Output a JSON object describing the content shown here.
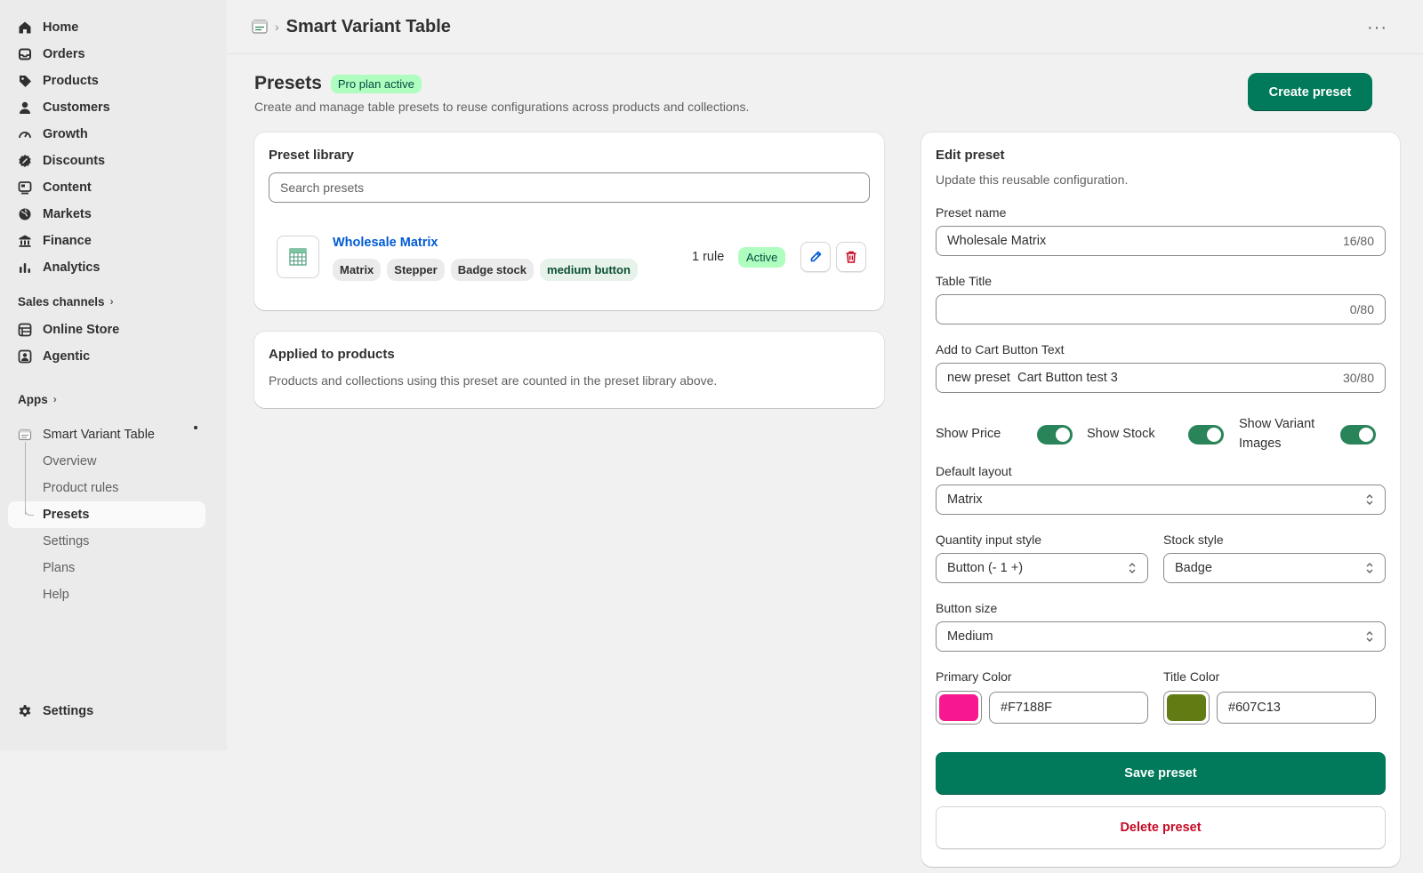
{
  "sidebar": {
    "nav": [
      {
        "label": "Home",
        "icon": "home-icon"
      },
      {
        "label": "Orders",
        "icon": "inbox-icon"
      },
      {
        "label": "Products",
        "icon": "tag-icon"
      },
      {
        "label": "Customers",
        "icon": "person-icon"
      },
      {
        "label": "Growth",
        "icon": "gauge-icon"
      },
      {
        "label": "Discounts",
        "icon": "discount-icon"
      },
      {
        "label": "Content",
        "icon": "content-icon"
      },
      {
        "label": "Markets",
        "icon": "globe-icon"
      },
      {
        "label": "Finance",
        "icon": "bank-icon"
      },
      {
        "label": "Analytics",
        "icon": "bar-chart-icon"
      }
    ],
    "sales_channels_label": "Sales channels",
    "channels": [
      {
        "label": "Online Store",
        "icon": "store-icon"
      },
      {
        "label": "Agentic",
        "icon": "agent-icon"
      }
    ],
    "apps_label": "Apps",
    "app_name": "Smart Variant Table",
    "app_items": [
      "Overview",
      "Product rules",
      "Presets",
      "Settings",
      "Plans",
      "Help"
    ],
    "settings_label": "Settings"
  },
  "topbar": {
    "title": "Smart Variant Table",
    "separator": "›",
    "more": "···"
  },
  "page": {
    "title": "Presets",
    "badge": "Pro plan active",
    "subtitle": "Create and manage table presets to reuse configurations across products and collections.",
    "create_button": "Create preset"
  },
  "library": {
    "title": "Preset library",
    "search_placeholder": "Search presets",
    "preset": {
      "name": "Wholesale Matrix",
      "tags": [
        "Matrix",
        "Stepper",
        "Badge stock",
        "medium button"
      ],
      "rules": "1 rule",
      "status": "Active"
    }
  },
  "applied": {
    "title": "Applied to products",
    "description": "Products and collections using this preset are counted in the preset library above."
  },
  "edit": {
    "title": "Edit preset",
    "subtitle": "Update this reusable configuration.",
    "preset_name_label": "Preset name",
    "preset_name_value": "Wholesale Matrix",
    "preset_name_count": "16/80",
    "table_title_label": "Table Title",
    "table_title_value": "",
    "table_title_count": "0/80",
    "cart_text_label": "Add to Cart Button Text",
    "cart_text_value": "new preset  Cart Button test 3",
    "cart_text_count": "30/80",
    "toggles": [
      {
        "label": "Show Price",
        "on": true
      },
      {
        "label": "Show Stock",
        "on": true
      },
      {
        "label": "Show Variant Images",
        "on": true
      }
    ],
    "default_layout_label": "Default layout",
    "default_layout_value": "Matrix",
    "quantity_style_label": "Quantity input style",
    "quantity_style_value": "Button (- 1 +)",
    "stock_style_label": "Stock style",
    "stock_style_value": "Badge",
    "button_size_label": "Button size",
    "button_size_value": "Medium",
    "primary_color_label": "Primary Color",
    "primary_color_value": "#F7188F",
    "title_color_label": "Title Color",
    "title_color_value": "#607C13",
    "save_button": "Save preset",
    "delete_button": "Delete preset"
  },
  "colors": {
    "accent_green": "#007a5a",
    "link_blue": "#005bd3",
    "critical_red": "#c70a24",
    "primary_swatch": "#F7188F",
    "title_swatch": "#607C13"
  }
}
